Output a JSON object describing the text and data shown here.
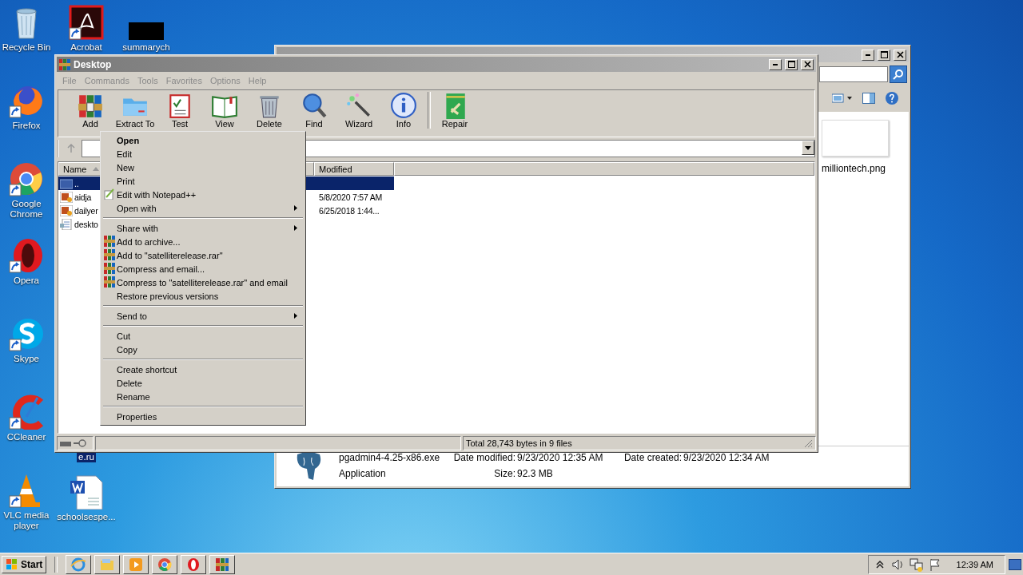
{
  "desktop_icons": [
    {
      "label": "Recycle Bin",
      "kind": "recycle",
      "shortcut": false,
      "selected": false
    },
    {
      "label": "Acrobat",
      "kind": "acrobat",
      "shortcut": true,
      "selected": false
    },
    {
      "label": "summarych",
      "kind": "blackbox",
      "shortcut": false,
      "selected": false
    },
    {
      "label": "Firefox",
      "kind": "firefox",
      "shortcut": true,
      "selected": false
    },
    {
      "label": "Google Chrome",
      "kind": "chrome",
      "shortcut": true,
      "selected": false
    },
    {
      "label": "Opera",
      "kind": "opera",
      "shortcut": true,
      "selected": false
    },
    {
      "label": "Skype",
      "kind": "skype",
      "shortcut": true,
      "selected": false
    },
    {
      "label": "CCleaner",
      "kind": "ccleaner",
      "shortcut": true,
      "selected": false
    },
    {
      "label": "VLC media player",
      "kind": "vlc",
      "shortcut": true,
      "selected": false
    },
    {
      "label": "e.ru",
      "kind": "covered",
      "shortcut": false,
      "selected": true
    },
    {
      "label": "schoolsespe...",
      "kind": "word",
      "shortcut": false,
      "selected": false
    }
  ],
  "back_window": {
    "thumbnail_label": "milliontech.png",
    "details": {
      "name": "pgadmin4-4.25-x86.exe",
      "type": "Application",
      "fields": [
        {
          "label": "Date modified:",
          "value": "9/23/2020 12:35 AM"
        },
        {
          "label": "Date created:",
          "value": "9/23/2020 12:34 AM"
        },
        {
          "label": "Size:",
          "value": "92.3 MB"
        }
      ]
    }
  },
  "winrar": {
    "title": "Desktop",
    "menu": [
      "File",
      "Commands",
      "Tools",
      "Favorites",
      "Options",
      "Help"
    ],
    "toolbar": [
      {
        "label": "Add",
        "kind": "add"
      },
      {
        "label": "Extract To",
        "kind": "extract"
      },
      {
        "label": "Test",
        "kind": "test"
      },
      {
        "label": "View",
        "kind": "view"
      },
      {
        "label": "Delete",
        "kind": "delete"
      },
      {
        "label": "Find",
        "kind": "find"
      },
      {
        "label": "Wizard",
        "kind": "wizard"
      },
      {
        "label": "Info",
        "kind": "info"
      },
      {
        "label": "Repair",
        "kind": "repair"
      }
    ],
    "columns": [
      {
        "label": "Name",
        "sorted": true
      },
      {
        "label": "Modified",
        "sorted": false
      }
    ],
    "rows": [
      {
        "name": "..",
        "kind": "up",
        "selected": true
      },
      {
        "name": "aidja",
        "kind": "image",
        "modified": "5/8/2020 7:57 AM",
        "selected": false
      },
      {
        "name": "dailyer",
        "kind": "image",
        "modified": "6/25/2018 1:44...",
        "selected": false
      },
      {
        "name": "deskto",
        "kind": "settings",
        "selected": false
      }
    ],
    "status": "Total 28,743 bytes in 9 files"
  },
  "context_menu": {
    "groups": [
      [
        {
          "label": "Open",
          "default": true,
          "kind": "plain",
          "submenu": false
        },
        {
          "label": "Edit",
          "default": false,
          "kind": "plain",
          "submenu": false
        },
        {
          "label": "New",
          "default": false,
          "kind": "plain",
          "submenu": false
        },
        {
          "label": "Print",
          "default": false,
          "kind": "plain",
          "submenu": false
        },
        {
          "label": "Edit with Notepad++",
          "default": false,
          "kind": "notepad",
          "submenu": false
        },
        {
          "label": "Open with",
          "default": false,
          "kind": "plain",
          "submenu": true
        }
      ],
      [
        {
          "label": "Share with",
          "default": false,
          "kind": "plain",
          "submenu": true
        },
        {
          "label": "Add to archive...",
          "default": false,
          "kind": "archiver",
          "submenu": false
        },
        {
          "label": "Add to \"satelliterelease.rar\"",
          "default": false,
          "kind": "archiver",
          "submenu": false
        },
        {
          "label": "Compress and email...",
          "default": false,
          "kind": "archiver",
          "submenu": false
        },
        {
          "label": "Compress to \"satelliterelease.rar\" and email",
          "default": false,
          "kind": "archiver",
          "submenu": false
        },
        {
          "label": "Restore previous versions",
          "default": false,
          "kind": "plain",
          "submenu": false
        }
      ],
      [
        {
          "label": "Send to",
          "default": false,
          "kind": "plain",
          "submenu": true
        }
      ],
      [
        {
          "label": "Cut",
          "default": false,
          "kind": "plain",
          "submenu": false
        },
        {
          "label": "Copy",
          "default": false,
          "kind": "plain",
          "submenu": false
        }
      ],
      [
        {
          "label": "Create shortcut",
          "default": false,
          "kind": "plain",
          "submenu": false
        },
        {
          "label": "Delete",
          "default": false,
          "kind": "plain",
          "submenu": false
        },
        {
          "label": "Rename",
          "default": false,
          "kind": "plain",
          "submenu": false
        }
      ],
      [
        {
          "label": "Properties",
          "default": false,
          "kind": "plain",
          "submenu": false
        }
      ]
    ]
  },
  "taskbar": {
    "start": "Start",
    "pinned": [
      {
        "kind": "ie"
      },
      {
        "kind": "explorer"
      },
      {
        "kind": "media"
      },
      {
        "kind": "chrome"
      },
      {
        "kind": "opera"
      },
      {
        "kind": "winrar"
      }
    ],
    "tray": [
      {
        "kind": "chevron"
      },
      {
        "kind": "speaker"
      },
      {
        "kind": "network"
      },
      {
        "kind": "flag"
      }
    ],
    "clock": "12:39 AM"
  }
}
